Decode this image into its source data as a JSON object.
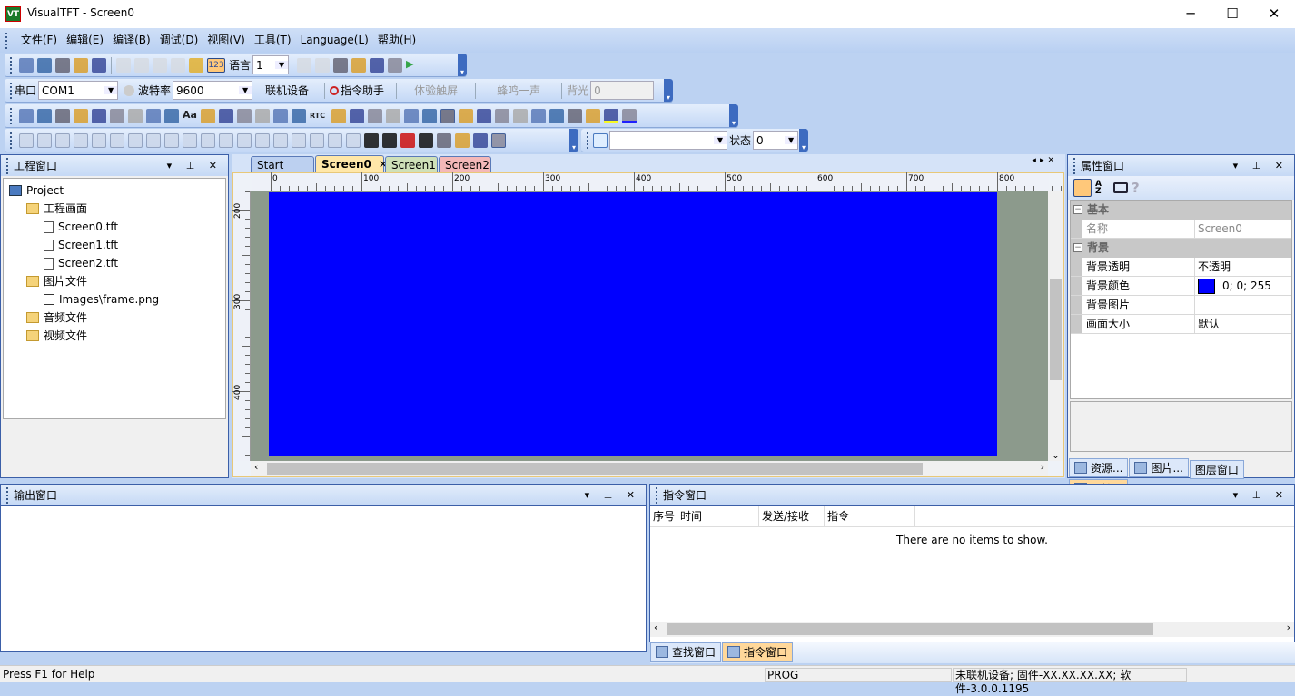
{
  "window": {
    "title": "VisualTFT - Screen0",
    "icon_text": "VT",
    "minimize": "─",
    "maximize": "☐",
    "close": "✕"
  },
  "menu": [
    "文件(F)",
    "编辑(E)",
    "编译(B)",
    "调试(D)",
    "视图(V)",
    "工具(T)",
    "Language(L)",
    "帮助(H)"
  ],
  "toolbar1": {
    "icons_a": [
      "new-project-icon",
      "open-project-icon",
      "new-file-icon",
      "open-folder-icon",
      "save-icon"
    ],
    "icons_b": [
      "cut-disabled-icon",
      "cut-icon",
      "copy-icon",
      "paste-icon",
      "lock-icon"
    ],
    "toggle_123": "123",
    "language_label": "语言",
    "language_value": "1",
    "icons_c": [
      "undo-icon",
      "redo-icon",
      "compile-icon",
      "tools-icon",
      "download-icon",
      "load-icon",
      "run-icon"
    ]
  },
  "toolbar2": {
    "port_label": "串口",
    "port_value": "COM1",
    "baud_label": "波特率",
    "baud_value": "9600",
    "connect": "联机设备",
    "cmd_helper": "指令助手",
    "touch_test": "体验触屏",
    "beep": "蜂鸣一声",
    "backlight_label": "背光",
    "backlight_value": "0"
  },
  "toolbar3": {
    "icons": [
      "pointer-icon",
      "pen-icon",
      "line-icon",
      "rectangle-icon",
      "filled-rectangle-icon",
      "circle-icon",
      "filled-circle-icon",
      "ellipse-icon",
      "filled-ellipse-icon",
      "text-icon",
      "image-icon",
      "button-icon",
      "textbox-icon",
      "number-box-icon",
      "clock-icon",
      "slider-icon",
      "rtc-icon",
      "animation-icon",
      "traffic-light-icon",
      "curve-icon",
      "data-record-icon",
      "menu-list-icon",
      "qrcode-icon",
      "table-icon",
      "graph-icon",
      "circle-gauge-icon",
      "refresh-icon",
      "icon-control-icon",
      "video-icon",
      "panel-icon",
      "brush-icon",
      "dropper-icon",
      "highlight-color-icon",
      "fill-color-icon"
    ],
    "text_icon_label": "Aa",
    "rtc_label": "RTC"
  },
  "toolbar4": {
    "icons": [
      "align-left-icon",
      "align-top-icon",
      "bring-front-icon",
      "send-back-icon",
      "align-right-icon",
      "align-bottom-icon",
      "distribute-h-icon",
      "distribute-v-icon",
      "same-width-icon",
      "same-height-icon",
      "center-h-icon",
      "center-v-icon",
      "space-h-icon",
      "space-v-icon",
      "center-both-icon",
      "center-page-icon",
      "resize-h-icon",
      "resize-v-icon",
      "fit-icon",
      "lock-icon",
      "unlock-icon",
      "hide-icon",
      "show-icon",
      "zoom-in-icon",
      "zoom-out-icon",
      "grid-icon",
      "ruler-icon"
    ],
    "state_label": "状态",
    "state_value": "0",
    "search_value": ""
  },
  "project_panel": {
    "title": "工程窗口",
    "tree": [
      {
        "label": "Project",
        "level": 0,
        "icon": "project"
      },
      {
        "label": "工程画面",
        "level": 1,
        "icon": "folder"
      },
      {
        "label": "Screen0.tft",
        "level": 2,
        "icon": "file"
      },
      {
        "label": "Screen1.tft",
        "level": 2,
        "icon": "file"
      },
      {
        "label": "Screen2.tft",
        "level": 2,
        "icon": "file"
      },
      {
        "label": "图片文件",
        "level": 1,
        "icon": "folder"
      },
      {
        "label": "Images\\frame.png",
        "level": 2,
        "icon": "image"
      },
      {
        "label": "音频文件",
        "level": 1,
        "icon": "folder"
      },
      {
        "label": "视频文件",
        "level": 1,
        "icon": "folder"
      }
    ]
  },
  "doc_tabs": [
    {
      "label": "Start Page",
      "color": "#bcd0f0"
    },
    {
      "label": "Screen0",
      "color": "#ffe7a8",
      "active": true,
      "close": "✕"
    },
    {
      "label": "Screen1",
      "color": "#cfe0b8"
    },
    {
      "label": "Screen2",
      "color": "#f4b8b8"
    }
  ],
  "ruler": {
    "h": [
      "0",
      "100",
      "200",
      "300",
      "400",
      "500",
      "600",
      "700",
      "800"
    ],
    "v": [
      "200",
      "300",
      "400"
    ]
  },
  "canvas": {
    "background": "#0000ff",
    "margin_color": "#8c9a8c"
  },
  "property_panel": {
    "title": "属性窗口",
    "categories": [
      {
        "name": "基本",
        "rows": [
          {
            "key": "名称",
            "value": "Screen0",
            "disabled": true
          }
        ]
      },
      {
        "name": "背景",
        "rows": [
          {
            "key": "背景透明",
            "value": "不透明"
          },
          {
            "key": "背景颜色",
            "value": "0; 0; 255",
            "swatch": "#0000ff"
          },
          {
            "key": "背景图片",
            "value": ""
          },
          {
            "key": "画面大小",
            "value": "默认"
          }
        ]
      }
    ],
    "bottom_tabs": [
      "资源...",
      "图片...",
      "图层窗口",
      "属性..."
    ]
  },
  "output_panel": {
    "title": "输出窗口"
  },
  "command_panel": {
    "title": "指令窗口",
    "columns": [
      "序号",
      "时间",
      "发送/接收",
      "指令"
    ],
    "empty_text": "There are no items to show.",
    "bottom_tabs": [
      "查找窗口",
      "指令窗口"
    ]
  },
  "status": {
    "help": "Press F1 for Help",
    "mode": "PROG",
    "device": "未联机设备; 固件-XX.XX.XX.XX;  软件-3.0.0.1195"
  }
}
